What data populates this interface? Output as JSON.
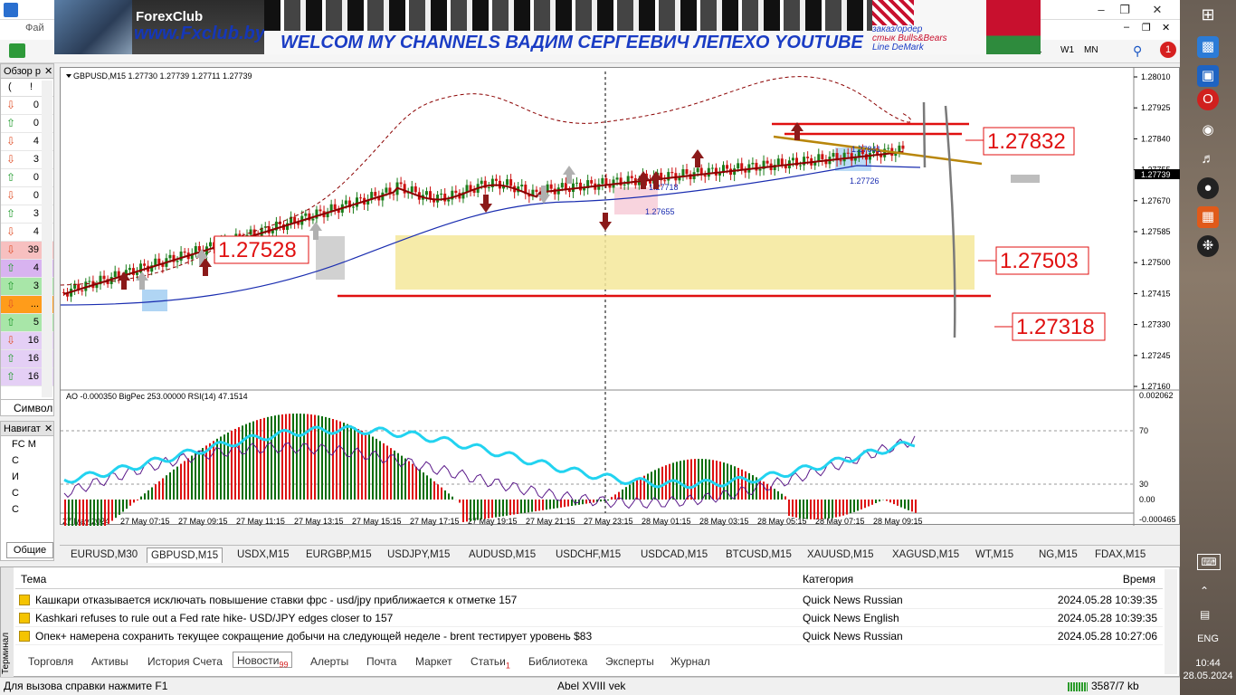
{
  "banner": {
    "fx_logo": "ForexClub",
    "fx_url": "www.Fxclub.by",
    "welcome": "WELCOM MY CHANNELS ВАДИМ СЕРГЕЕВИЧ ЛЕПЕХО YOUTUBE",
    "order_line1": "заказ/ордер",
    "order_line2": "стык Bulls&Bears",
    "order_line3": "Line DeMark"
  },
  "menubar": {
    "file": "Фай"
  },
  "toolbar": {
    "w1": "W1",
    "mn": "MN",
    "notify_count": "1"
  },
  "market_watch": {
    "title": "Обзор р",
    "col_a": "(",
    "col_b": "!",
    "rows": [
      {
        "dir": "down",
        "val": "0"
      },
      {
        "dir": "up",
        "val": "0"
      },
      {
        "dir": "down",
        "val": "4"
      },
      {
        "dir": "down",
        "val": "3"
      },
      {
        "dir": "up",
        "val": "0"
      },
      {
        "dir": "down",
        "val": "0"
      },
      {
        "dir": "up",
        "val": "3"
      },
      {
        "dir": "down",
        "val": "4"
      },
      {
        "dir": "down",
        "val": "39"
      },
      {
        "dir": "up",
        "val": "4"
      },
      {
        "dir": "up",
        "val": "3"
      },
      {
        "dir": "down",
        "val": "..."
      },
      {
        "dir": "up",
        "val": "5"
      },
      {
        "dir": "down",
        "val": "16"
      },
      {
        "dir": "up",
        "val": "16"
      },
      {
        "dir": "up",
        "val": "16"
      }
    ],
    "symbols_tab": "Символ"
  },
  "navigator": {
    "title": "Навигат",
    "items": [
      "FC M",
      "С",
      "И",
      "С",
      "С"
    ],
    "tab": "Общие"
  },
  "chart": {
    "header": "GBPUSD,M15  1.27730 1.27739 1.27711 1.27739",
    "indicator_header": "AO -0.000350  BigPec 253.00000  RSI(14) 47.1514",
    "current_price": "1.27739",
    "price_ticks": [
      "1.28010",
      "1.27925",
      "1.27840",
      "1.27755",
      "1.27670",
      "1.27585",
      "1.27500",
      "1.27415",
      "1.27330",
      "1.27245",
      "1.27160"
    ],
    "ind_ticks": [
      "0.002062",
      "70",
      "30",
      "0.00",
      "-0.000465"
    ],
    "time_ticks": [
      "27 May 2024",
      "27 May 07:15",
      "27 May 09:15",
      "27 May 11:15",
      "27 May 13:15",
      "27 May 15:15",
      "27 May 17:15",
      "27 May 19:15",
      "27 May 21:15",
      "27 May 23:15",
      "28 May 01:15",
      "28 May 03:15",
      "28 May 05:15",
      "28 May 07:15",
      "28 May 09:15"
    ],
    "levels": {
      "l1": "1.27832",
      "l2": "1.27503",
      "l3": "1.27318",
      "l4": "1.27528",
      "small1": "1.27655",
      "small2": "1.27718",
      "small3": "1.27726",
      "small4": "1.27841"
    }
  },
  "chart_tabs": [
    "EURUSD,M30",
    "GBPUSD,M15",
    "USDX,M15",
    "EURGBP,M15",
    "USDJPY,M15",
    "AUDUSD,M15",
    "USDCHF,M15",
    "USDCAD,M15",
    "BTCUSD,M15",
    "XAUUSD,M15",
    "XAGUSD,M15",
    "WT,M15",
    "NG,M15",
    "FDAX,M15"
  ],
  "terminal": {
    "side_label": "Терминал",
    "col_topic": "Тема",
    "col_category": "Категория",
    "col_time": "Время",
    "news": [
      {
        "title": "Кашкари отказывается исключать повышение ставки фрс - usd/jpy приближается к отметке 157",
        "category": "Quick News Russian",
        "time": "2024.05.28 10:39:35"
      },
      {
        "title": "Kashkari refuses to rule out a Fed rate hike- USD/JPY edges closer to 157",
        "category": "Quick News English",
        "time": "2024.05.28 10:39:35"
      },
      {
        "title": "Опек+ намерена сохранить текущее сокращение добычи на следующей неделе - brent тестирует уровень $83",
        "category": "Quick News Russian",
        "time": "2024.05.28 10:27:06"
      }
    ],
    "tabs": [
      {
        "label": "Торговля"
      },
      {
        "label": "Активы"
      },
      {
        "label": "История Счета"
      },
      {
        "label": "Новости",
        "badge": "99"
      },
      {
        "label": "Алерты"
      },
      {
        "label": "Почта"
      },
      {
        "label": "Маркет"
      },
      {
        "label": "Статьи",
        "badge": "1"
      },
      {
        "label": "Библиотека"
      },
      {
        "label": "Эксперты"
      },
      {
        "label": "Журнал"
      }
    ]
  },
  "statusbar": {
    "help": "Для вызова справки нажмите F1",
    "profile": "Abel XVIII vek",
    "traffic": "3587/7 kb"
  },
  "taskbar": {
    "lang": "ENG",
    "time": "10:44",
    "date": "28.05.2024"
  }
}
